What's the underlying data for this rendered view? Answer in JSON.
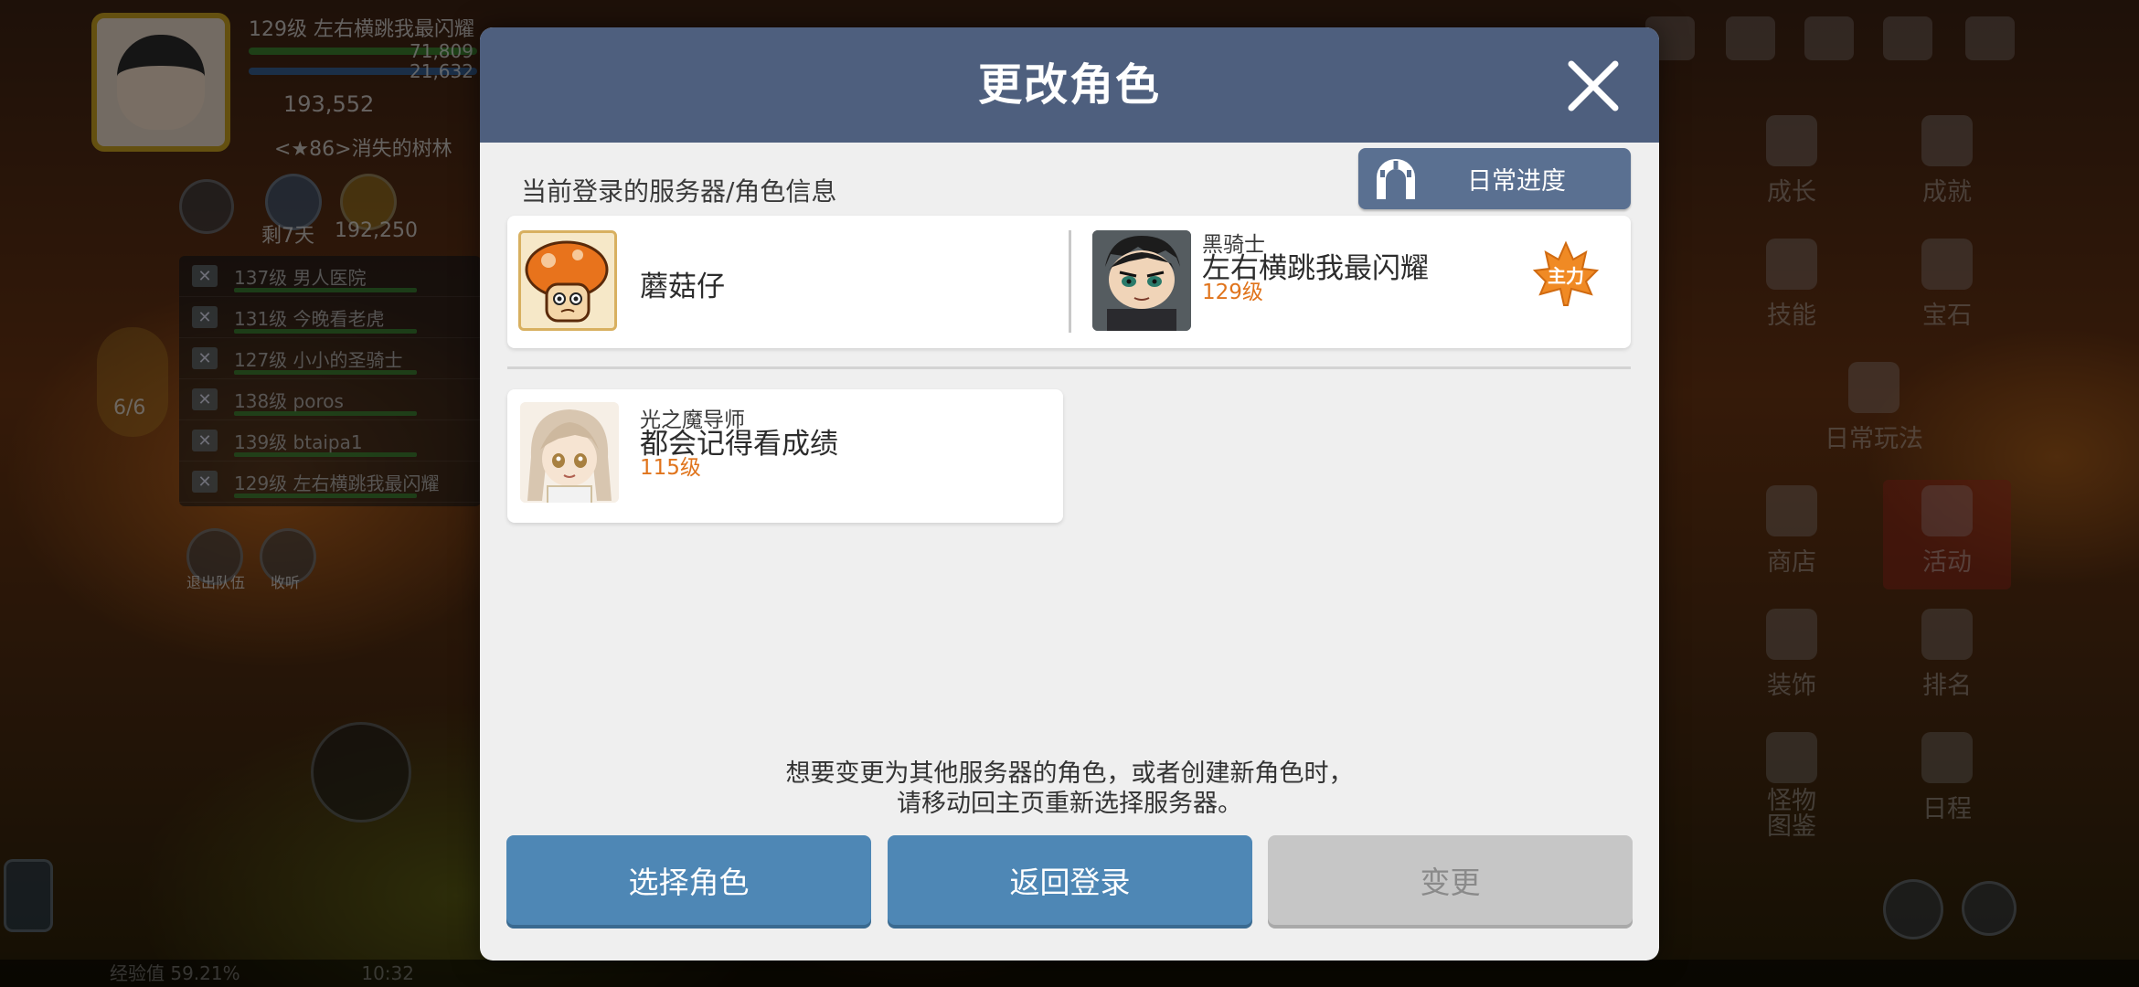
{
  "hud": {
    "level_name": "129级 左右横跳我最闪耀",
    "hp": "71,809",
    "mp": "21,632",
    "power": "193,552",
    "map": "<★86>消失的树林",
    "gold": "192,250",
    "days": "剩7天",
    "party_count": "6/6",
    "party": [
      {
        "label": "137级  男人医院"
      },
      {
        "label": "131级  今晚看老虎"
      },
      {
        "label": "127级  小小的圣骑士"
      },
      {
        "label": "138级  poros"
      },
      {
        "label": "139级  btaipa1"
      },
      {
        "label": "129级  左右横跳我最闪耀"
      }
    ],
    "leave_party": "退出队伍",
    "listen": "收听",
    "exp": "经验值 59.21%",
    "time": "10:32"
  },
  "side_menu": {
    "growth": "成长",
    "achievement": "成就",
    "skill": "技能",
    "gem": "宝石",
    "daily_play": "日常玩法",
    "shop": "商店",
    "event": "活动",
    "decor": "装饰",
    "ranking": "排名",
    "monster_book": "怪物\n图鉴",
    "schedule": "日程"
  },
  "dialog": {
    "title": "更改角色",
    "section_label": "当前登录的服务器/角色信息",
    "daily_progress": "日常进度",
    "current_server": {
      "name": "蘑菇仔"
    },
    "current_character": {
      "job": "黑骑士",
      "name": "左右横跳我最闪耀",
      "level": "129级",
      "badge": "主力"
    },
    "other_characters": [
      {
        "job": "光之魔导师",
        "name": "都会记得看成绩",
        "level": "115级"
      }
    ],
    "notice_line1": "想要变更为其他服务器的角色，或者创建新角色时，",
    "notice_line2": "请移动回主页重新选择服务器。",
    "buttons": {
      "select": "选择角色",
      "back_login": "返回登录",
      "change": "变更"
    }
  },
  "colors": {
    "header": "#4e5f7e",
    "primary_button": "#4e87b5",
    "disabled_button": "#c6c6c6",
    "level_text": "#e0741c"
  }
}
